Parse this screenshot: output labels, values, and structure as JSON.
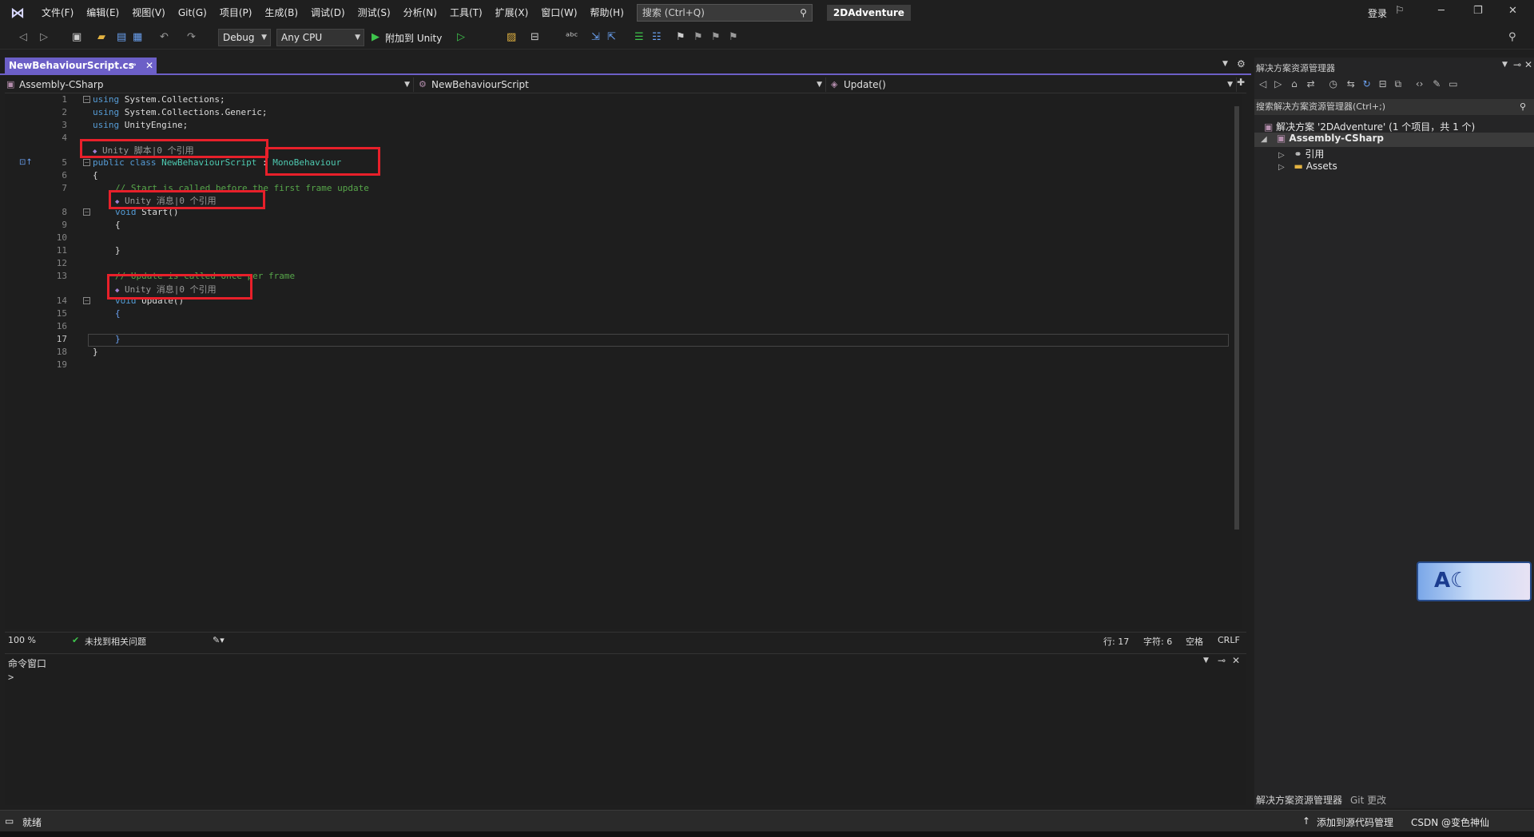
{
  "menu": {
    "items": [
      "文件(F)",
      "编辑(E)",
      "视图(V)",
      "Git(G)",
      "项目(P)",
      "生成(B)",
      "调试(D)",
      "测试(S)",
      "分析(N)",
      "工具(T)",
      "扩展(X)",
      "窗口(W)",
      "帮助(H)"
    ],
    "search_placeholder": "搜索 (Ctrl+Q)",
    "solution_name": "2DAdventure",
    "login": "登录"
  },
  "toolbar": {
    "config": "Debug",
    "platform": "Any CPU",
    "attach_label": "附加到 Unity"
  },
  "document_tab": {
    "title": "NewBehaviourScript.cs"
  },
  "navbar": {
    "project": "Assembly-CSharp",
    "type": "NewBehaviourScript",
    "member": "Update()"
  },
  "editor": {
    "line_numbers": [
      "1",
      "2",
      "3",
      "4",
      "5",
      "6",
      "7",
      "8",
      "9",
      "10",
      "11",
      "12",
      "13",
      "14",
      "15",
      "16",
      "17",
      "18",
      "19"
    ],
    "code": {
      "l1_kw": "using",
      "l1_rest": " System.Collections;",
      "l2_kw": "using",
      "l2_rest": " System.Collections.Generic;",
      "l3_kw": "using",
      "l3_rest": " UnityEngine;",
      "l5_kw": "public class",
      "l5_cls": " NewBehaviourScript",
      "l5_colon": " : ",
      "l5_base": "MonoBehaviour",
      "l6": "{",
      "l7": "// Start is called before the first frame update",
      "l8_kw": "void",
      "l8_rest": " Start()",
      "l9": "{",
      "l11": "}",
      "l13": "// Update is called once per frame",
      "l14_kw": "void",
      "l14_rest": " Update()",
      "l15": "{",
      "l17": "}",
      "l18": "}"
    },
    "codelens": {
      "class_lens": "Unity 脚本|0 个引用",
      "start_lens": "Unity 消息|0 个引用",
      "update_lens": "Unity 消息|0 个引用"
    }
  },
  "editor_status": {
    "zoom": "100 %",
    "issues": "未找到相关问题",
    "line": "行: 17",
    "column": "字符: 6",
    "whitespace": "空格",
    "eol": "CRLF"
  },
  "command_window": {
    "title": "命令窗口",
    "prompt": ">"
  },
  "solution_explorer": {
    "title": "解决方案资源管理器",
    "search_placeholder": "搜索解决方案资源管理器(Ctrl+;)",
    "solution_row": "解决方案 '2DAdventure' (1 个项目，共 1 个)",
    "project_row": "Assembly-CSharp",
    "references_row": "引用",
    "assets_row": "Assets",
    "tab_active": "解决方案资源管理器",
    "tab_git": "Git 更改"
  },
  "status_bar": {
    "ready": "就绪",
    "source_control": "添加到源代码管理",
    "watermark": "CSDN @变色神仙"
  },
  "avatar_text": "A☾",
  "colors": {
    "accent": "#6c5fc7",
    "highlight_box": "#e8202a",
    "keyword": "#569cd6",
    "type": "#4ec9b0",
    "comment": "#57a64a"
  }
}
